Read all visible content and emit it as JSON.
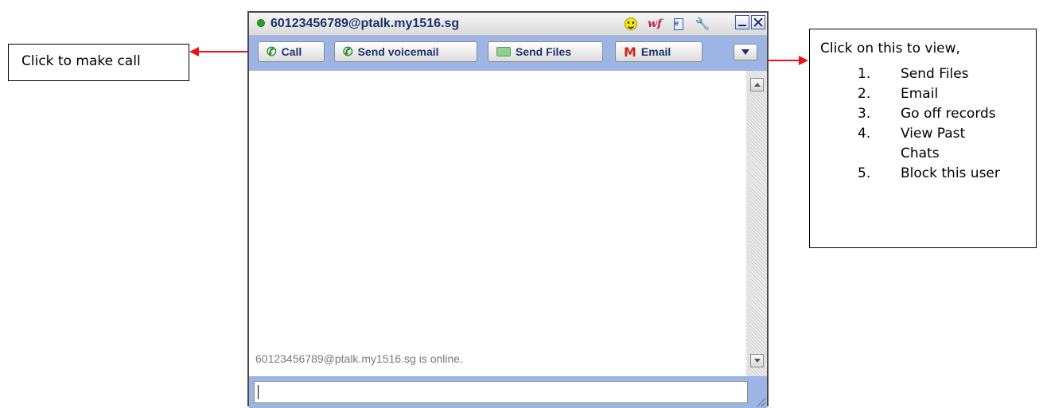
{
  "window": {
    "title": "60123456789@ptalk.my1516.sg",
    "status_color": "#25a025",
    "title_icons": [
      "smiley-icon",
      "wf-icon",
      "note-icon",
      "wrench-icon"
    ],
    "wf_label": "wf"
  },
  "toolbar": {
    "call_label": "Call",
    "voicemail_label": "Send voicemail",
    "files_label": "Send Files",
    "email_label": "Email",
    "accent": "#9db5e4"
  },
  "chat": {
    "status_message": "60123456789@ptalk.my1516.sg is online.",
    "input_value": ""
  },
  "callouts": {
    "left": {
      "text": "Click to make call"
    },
    "right": {
      "heading": "Click on this to view,",
      "items": [
        {
          "num": "1.",
          "label": "Send Files"
        },
        {
          "num": "2.",
          "label": "Email"
        },
        {
          "num": "3.",
          "label": "Go off records"
        },
        {
          "num": "4.",
          "label": "View  Past Chats"
        },
        {
          "num": "5.",
          "label": "Block this user"
        }
      ]
    },
    "arrow_color": "#e8141b"
  }
}
